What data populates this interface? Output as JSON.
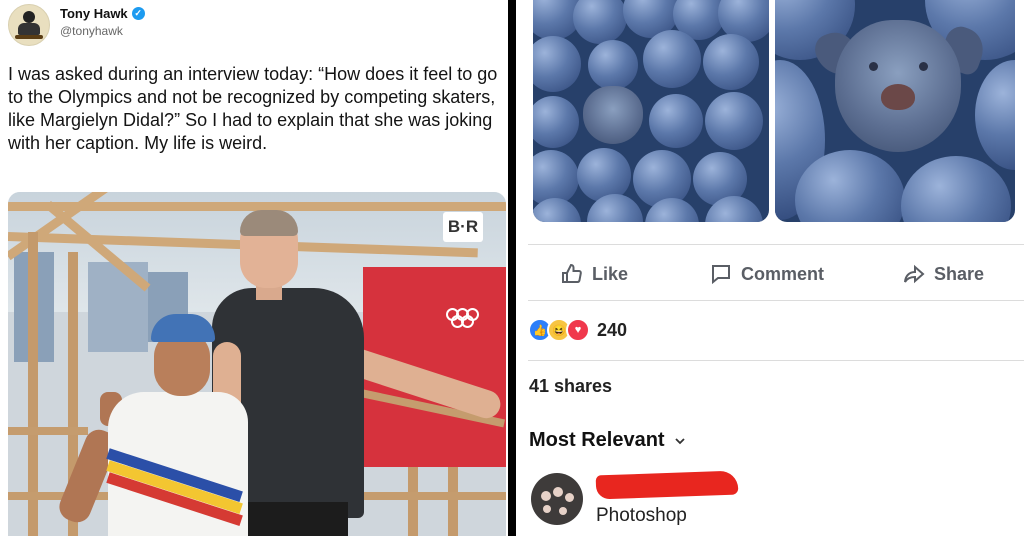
{
  "tweet": {
    "name": "Tony Hawk",
    "handle": "@tonyhawk",
    "text": "I was asked during an interview today: “How does it feel to go to the Olympics and not be recognized by competing skaters, like Margielyn Didal?” So I had to explain that she was joking with her caption. My life is weird.",
    "photo_watermark": "B·R"
  },
  "facebook": {
    "actions": {
      "like": "Like",
      "comment": "Comment",
      "share": "Share"
    },
    "reaction_count": "240",
    "shares": "41 shares",
    "sort_label": "Most Relevant",
    "comment_text": "Photoshop"
  },
  "colors": {
    "verified": "#1d9bf0",
    "like_reaction": "#2d7ff9",
    "love_reaction": "#f0384c",
    "haha_reaction": "#f7c542",
    "redaction": "#e8261f"
  }
}
